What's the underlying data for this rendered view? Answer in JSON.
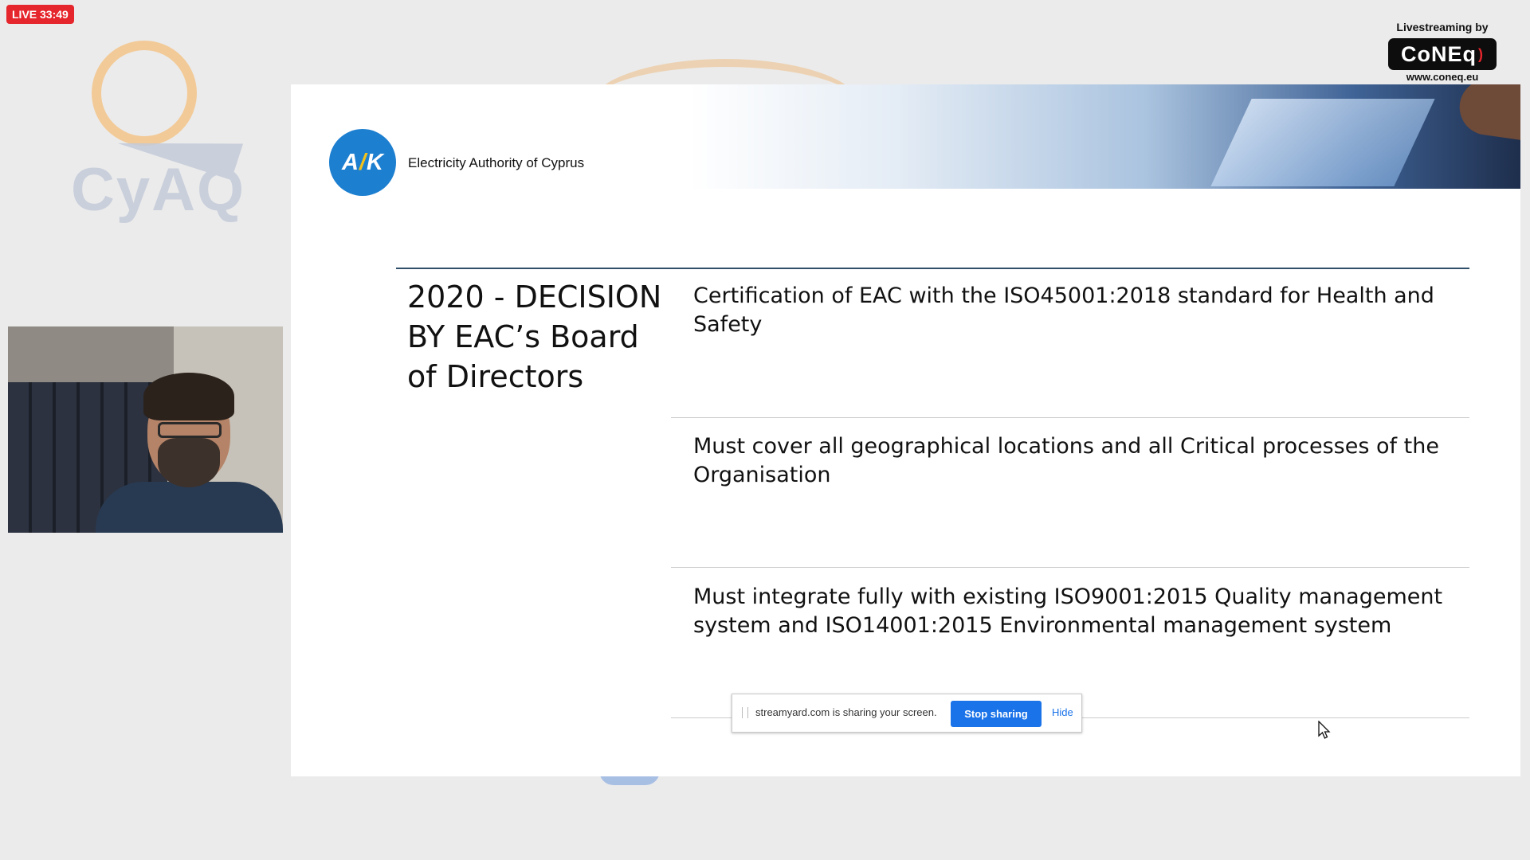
{
  "live_badge": "LIVE 33:49",
  "watermark": {
    "logo_text": "CyAQ",
    "icon": "cyaq-logo-icon"
  },
  "credit": {
    "label": "Livestreaming by",
    "brand": "CoNEq",
    "url": "www.coneq.eu"
  },
  "slide": {
    "org_logo": {
      "left": "A",
      "bolt": "/",
      "right": "K"
    },
    "org_name": "Electricity Authority of Cyprus",
    "title": "2020 - DECISION BY EAC’s Board of Directors",
    "items": [
      "Certification of EAC with the ISO45001:2018 standard for Health and Safety",
      "Must cover all geographical locations and all Critical processes of the Organisation",
      "Must integrate fully with existing ISO9001:2015 Quality management system and ISO14001:2015 Environmental management system"
    ]
  },
  "share_bar": {
    "message": "streamyard.com is sharing your screen.",
    "stop_label": "Stop sharing",
    "hide_label": "Hide"
  },
  "colors": {
    "live_red": "#e5262c",
    "eac_blue": "#1d7fd0",
    "button_blue": "#1a73e8"
  }
}
